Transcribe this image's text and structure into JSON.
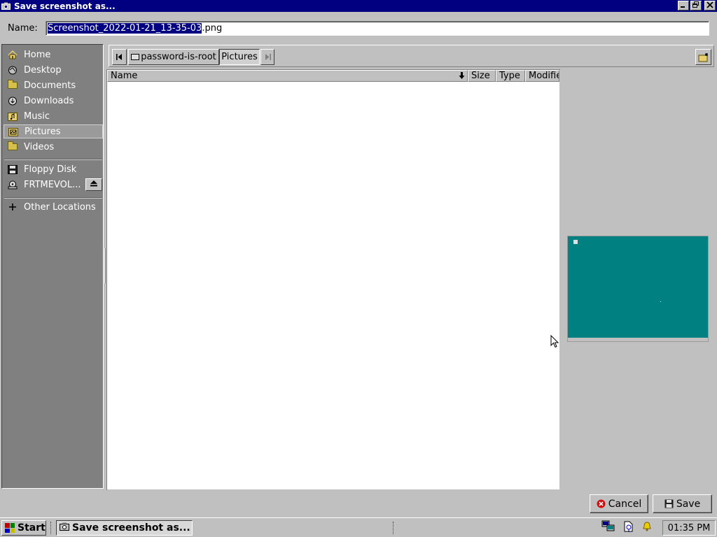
{
  "window": {
    "title": "Save screenshot as...",
    "app_icon": "camera-icon",
    "buttons": [
      "minimize-icon",
      "maximize-icon",
      "close-icon"
    ]
  },
  "name_field": {
    "label": "Name:",
    "selected_text": "Screenshot_2022-01-21_13-35-03",
    "unselected_text": ".png"
  },
  "sidebar": {
    "items": [
      {
        "label": "Home",
        "icon": "home-icon"
      },
      {
        "label": "Desktop",
        "icon": "desktop-icon"
      },
      {
        "label": "Documents",
        "icon": "documents-folder-icon"
      },
      {
        "label": "Downloads",
        "icon": "downloads-folder-icon"
      },
      {
        "label": "Music",
        "icon": "music-folder-icon"
      },
      {
        "label": "Pictures",
        "icon": "pictures-folder-icon",
        "active": true
      },
      {
        "label": "Videos",
        "icon": "videos-folder-icon"
      }
    ],
    "devices": [
      {
        "label": "Floppy Disk",
        "icon": "floppy-disk-icon"
      },
      {
        "label": "FRTMEVOL...",
        "icon": "cdrom-icon",
        "eject_icon": "eject-icon"
      }
    ],
    "other": {
      "label": "Other Locations",
      "icon": "plus-icon"
    }
  },
  "pathbar": {
    "back_icon": "left-arrow-icon",
    "forward_icon": "right-arrow-icon",
    "crumbs": [
      "password-is-root",
      "Pictures"
    ],
    "new_folder_icon": "new-folder-icon"
  },
  "file_list": {
    "columns": [
      "Name",
      "Size",
      "Type",
      "Modifie"
    ],
    "sort_icon": "sort-down-arrow-icon",
    "rows": []
  },
  "actions": {
    "cancel": "Cancel",
    "save": "Save"
  },
  "taskbar": {
    "start": "Start",
    "task": "Save screenshot as...",
    "clock": "01:35 PM",
    "tray_icons": [
      "network-icon",
      "security-icon",
      "notification-bell-icon"
    ]
  },
  "colors": {
    "titlebar": "#000080",
    "selection": "#000080",
    "desktop_preview": "#008080",
    "face": "#c0c0c0",
    "sidebar": "#808080"
  }
}
